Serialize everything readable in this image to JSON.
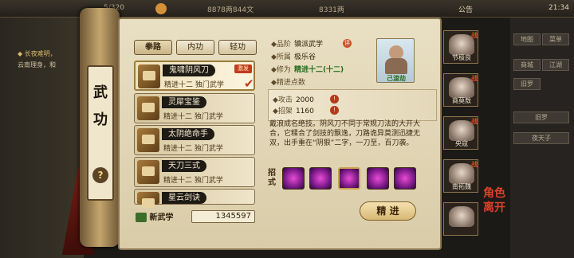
{
  "topbar": {
    "stamina": "5/320",
    "silver": "8878两844文",
    "gold": "8331两",
    "notice": "公告",
    "time": "21:34"
  },
  "chat": {
    "line1": "◆ 长夜难明，",
    "line2": "云南理身，和"
  },
  "right_menu": {
    "b1": "地图",
    "b2": "菜单",
    "b3": "商城",
    "b4": "江湖",
    "b5": "旧罗",
    "b6": "旧罗",
    "b7": "夜天子"
  },
  "scroll": {
    "title": "武功",
    "help": "?"
  },
  "tabs": [
    "拳路",
    "内功",
    "轻功"
  ],
  "skills": [
    {
      "name": "鬼啸阴风刀",
      "sub": "精进十二  独门武学",
      "badge": "激发"
    },
    {
      "name": "灵犀宝鉴",
      "sub": "精进十二  独门武学"
    },
    {
      "name": "太阴绝命手",
      "sub": "精进十二  独门武学"
    },
    {
      "name": "天刀三式",
      "sub": "精进十二  独门武学"
    },
    {
      "name": "星云剑诀",
      "sub": ""
    }
  ],
  "bottom": {
    "new_skill": "新武学",
    "coins": "1345597"
  },
  "info": {
    "rank_label": "品阶",
    "rank_value": "镇派武学",
    "rank_eval": "评",
    "sect_label": "所属",
    "sect_value": "极乐谷",
    "cultivation_label": "修为",
    "cultivation_value": "精进十二(十二)",
    "points_label": "精进点数",
    "portrait_name": "己渡劫",
    "attack_label": "攻击",
    "attack_value": "2000",
    "parry_label": "招架",
    "parry_value": "1160",
    "desc": "戴浪成名绝技。阴风刀不同于常规刀法的大开大合，它糅合了剑技的飘逸，刀路诡异莫测迅捷无双，出手重在“阴狠”二字，一刀至，百刀袭。",
    "moves_label": "招式",
    "advance_button": "精 进"
  },
  "roles": [
    {
      "name": "节极良",
      "tag": "战"
    },
    {
      "name": "商莫敖",
      "tag": "战"
    },
    {
      "name": "央寇",
      "tag": "战"
    },
    {
      "name": "南拓魏",
      "tag": "战"
    },
    {
      "name": "",
      "tag": ""
    }
  ],
  "role_footer": "角色 离开"
}
